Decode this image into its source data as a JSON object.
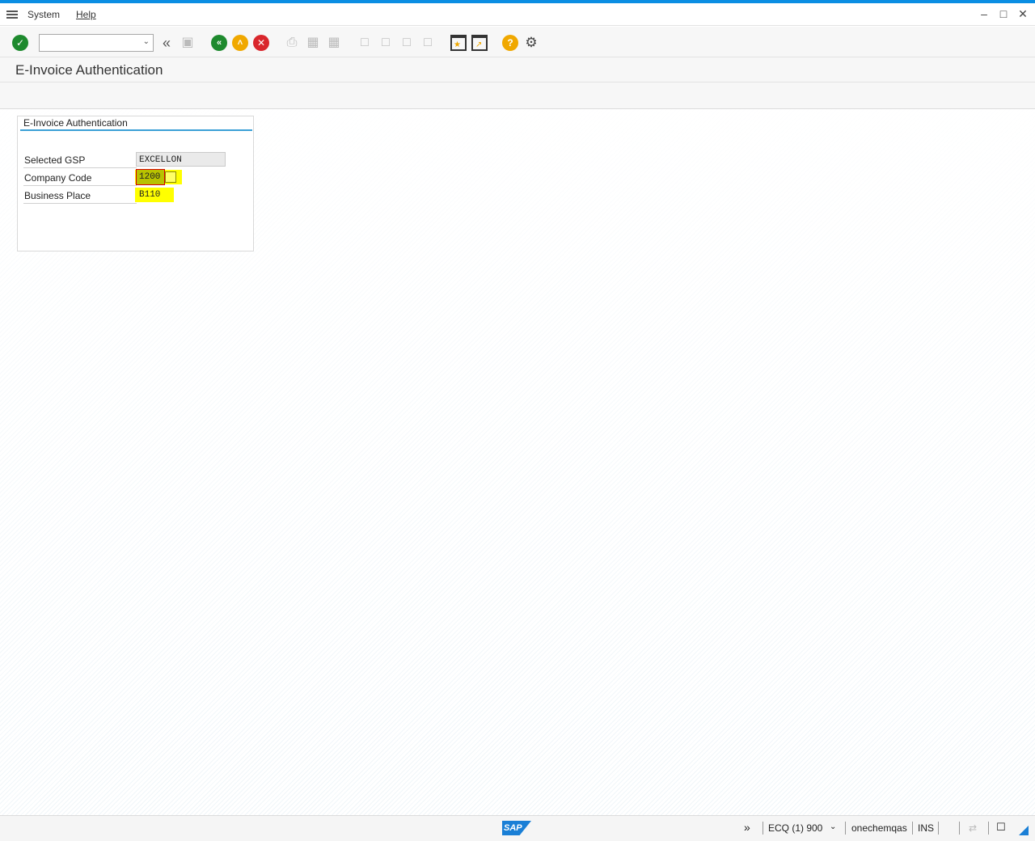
{
  "menubar": {
    "items": [
      "System",
      "Help"
    ],
    "accent": "#0a8ee3"
  },
  "toolbar": {
    "command_value": "",
    "icons": [
      "enter-icon",
      "back-double-icon",
      "save-icon",
      "back-icon",
      "exit-icon",
      "cancel-icon",
      "print-icon",
      "find-icon",
      "find-next-icon",
      "first-page-icon",
      "prev-page-icon",
      "next-page-icon",
      "last-page-icon",
      "new-session-icon",
      "shortcut-icon",
      "help-icon",
      "customize-icon"
    ]
  },
  "page": {
    "title": "E-Invoice Authentication"
  },
  "group": {
    "title": "E-Invoice Authentication",
    "fields": [
      {
        "label": "Selected GSP",
        "value": "EXCELLON"
      },
      {
        "label": "Company Code",
        "value": "1200"
      },
      {
        "label": "Business Place",
        "value": "B110"
      }
    ]
  },
  "status": {
    "system": "ECQ (1) 900",
    "server": "onechemqas",
    "mode": "INS",
    "logo": "SAP"
  }
}
